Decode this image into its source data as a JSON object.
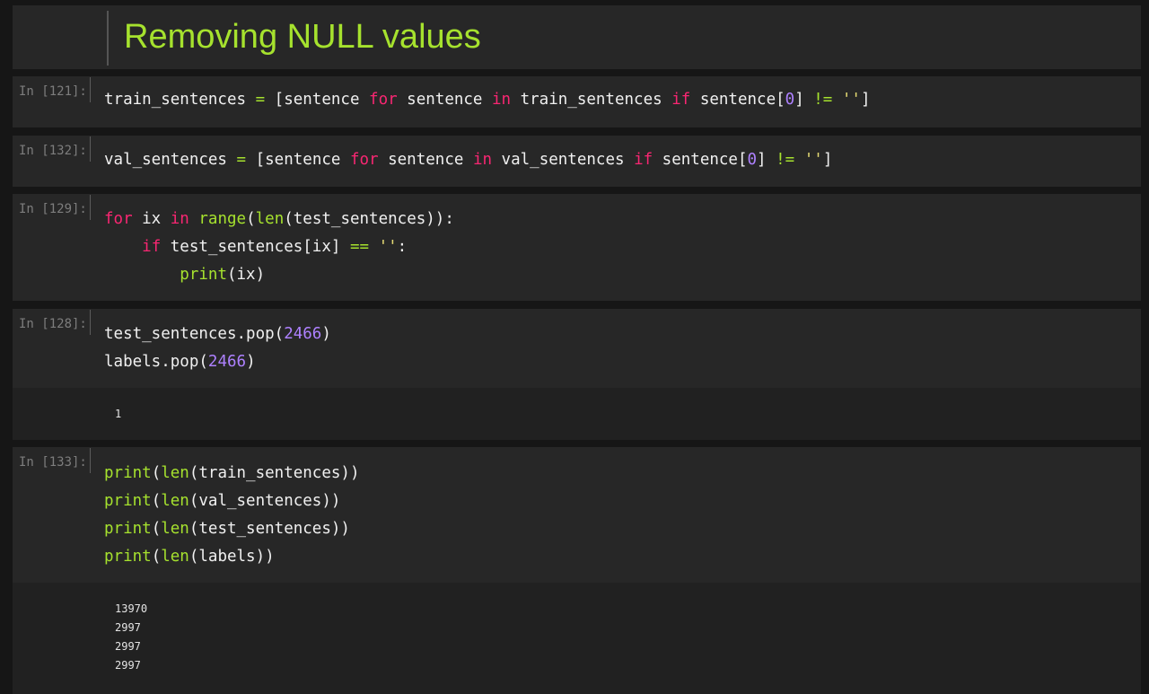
{
  "markdown": {
    "title": "Removing NULL values"
  },
  "colors": {
    "background": "#161616",
    "cell_background": "#272727",
    "output_background": "#212121",
    "heading": "#a6e22e",
    "keyword": "#f92672",
    "builtin_and_operator": "#a6e22e",
    "number": "#ae81ff",
    "prompt": "#7d7d7d",
    "code_text": "#f0f0f0"
  },
  "cells": [
    {
      "prompt": "In [121]:",
      "code": {
        "l1": {
          "a": "train_sentences ",
          "b": "=",
          "c": " [sentence ",
          "d": "for",
          "e": " sentence ",
          "f": "in",
          "g": " train_sentences ",
          "h": "if",
          "i": " sentence[",
          "j": "0",
          "k": "] ",
          "l": "!=",
          "m": " ",
          "n": "''",
          "o": "]"
        }
      }
    },
    {
      "prompt": "In [132]:",
      "code": {
        "l1": {
          "a": "val_sentences ",
          "b": "=",
          "c": " [sentence ",
          "d": "for",
          "e": " sentence ",
          "f": "in",
          "g": " val_sentences ",
          "h": "if",
          "i": " sentence[",
          "j": "0",
          "k": "] ",
          "l": "!=",
          "m": " ",
          "n": "''",
          "o": "]"
        }
      }
    },
    {
      "prompt": "In [129]:",
      "code": {
        "l1": {
          "a": "for",
          "b": " ix ",
          "c": "in",
          "d": " ",
          "e": "range",
          "f": "(",
          "g": "len",
          "h": "(test_sentences)):"
        },
        "l2": {
          "a": "    ",
          "b": "if",
          "c": " test_sentences[ix] ",
          "d": "==",
          "e": " ",
          "f": "''",
          "g": ":"
        },
        "l3": {
          "a": "        ",
          "b": "print",
          "c": "(ix)"
        }
      }
    },
    {
      "prompt": "In [128]:",
      "code": {
        "l1": {
          "a": "test_sentences.pop(",
          "b": "2466",
          "c": ")"
        },
        "l2": {
          "a": "labels.pop(",
          "b": "2466",
          "c": ")"
        }
      },
      "output": [
        "1"
      ]
    },
    {
      "prompt": "In [133]:",
      "code": {
        "l1": {
          "a": "print",
          "b": "(",
          "c": "len",
          "d": "(train_sentences))"
        },
        "l2": {
          "a": "print",
          "b": "(",
          "c": "len",
          "d": "(val_sentences))"
        },
        "l3": {
          "a": "print",
          "b": "(",
          "c": "len",
          "d": "(test_sentences))"
        },
        "l4": {
          "a": "print",
          "b": "(",
          "c": "len",
          "d": "(labels))"
        }
      },
      "output": [
        "13970",
        "2997",
        "2997",
        "2997"
      ]
    }
  ]
}
